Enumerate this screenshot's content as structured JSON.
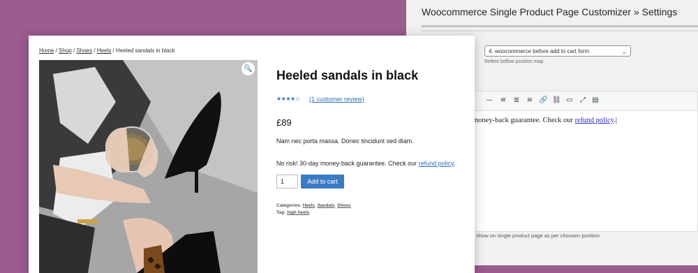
{
  "admin": {
    "title": "Woocommerce Single Product Page Customizer » Settings",
    "position_select": "4. woocommerce before add to cart form",
    "position_hint": "Refere bellow position map.",
    "editor_text_prefix": "money-back guarantee. Check our ",
    "editor_link": "refund policy",
    "editor_text_suffix": ".",
    "description": "e show on single product page as per choosen position.",
    "toolbar_icons": [
      "horizontal-rule",
      "align-left",
      "align-center",
      "align-right",
      "link",
      "unlink",
      "read-more",
      "fullscreen",
      "toolbar-toggle"
    ]
  },
  "breadcrumb": {
    "items": [
      "Home",
      "Shop",
      "Shoes",
      "Heels"
    ],
    "separator": "/",
    "current": "Heeled sandals in black"
  },
  "product": {
    "title": "Heeled sandals in black",
    "rating": 4.5,
    "rating_max": 5,
    "stars": "★★★★☆",
    "reviews_link": "(1 customer review)",
    "price": "£89",
    "description": "Nam nec porta massa. Donec tincidunt sed diam.",
    "norisk_prefix": "No risk! 30-day money-back guarantee. Check our ",
    "norisk_link": "refund policy",
    "norisk_suffix": ".",
    "quantity": "1",
    "add_to_cart": "Add to cart",
    "categories_label": "Categories:",
    "categories": [
      "Heels",
      "Sandals",
      "Shoes"
    ],
    "tag_label": "Tag:",
    "tag": "high heels"
  },
  "colors": {
    "background": "#9b5c8f",
    "button": "#3b7bc4",
    "link": "#2f6fb3"
  }
}
